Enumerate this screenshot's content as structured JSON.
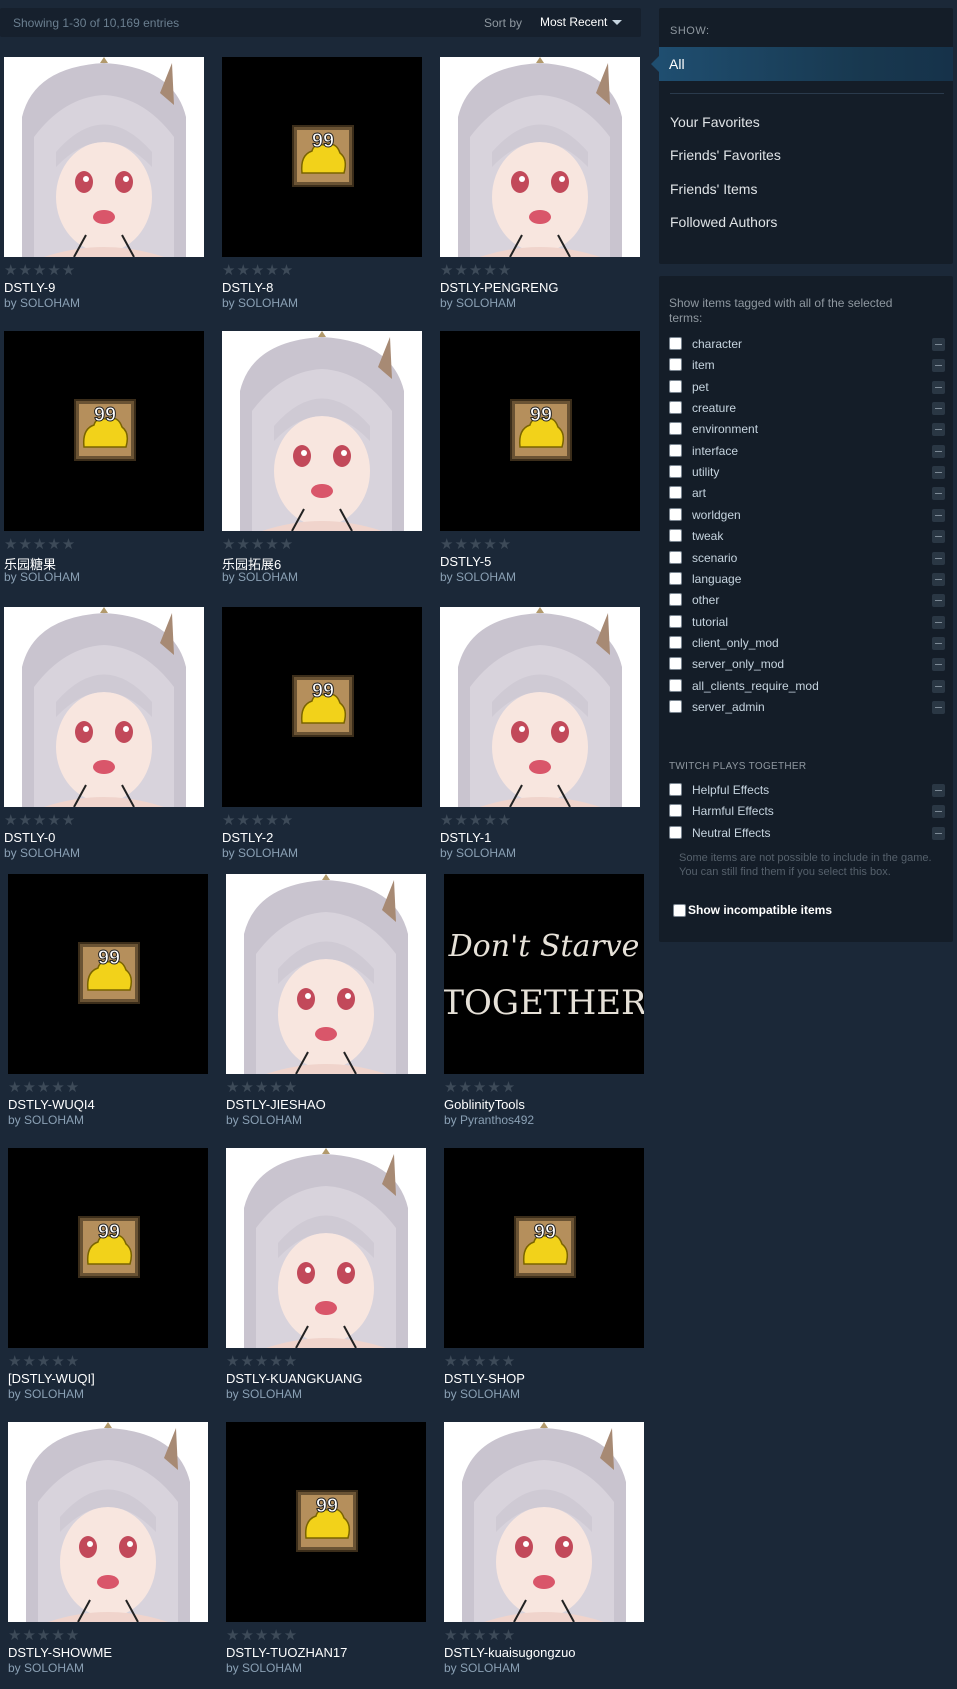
{
  "header": {
    "count_text": "Showing 1-30 of 10,169 entries",
    "sort_label": "Sort by",
    "sort_value": "Most Recent"
  },
  "items": [
    {
      "title": "DSTLY-9",
      "author": "by SOLOHAM",
      "thumb": "girl-portrait"
    },
    {
      "title": "DSTLY-8",
      "author": "by SOLOHAM",
      "thumb": "gold-99-icon"
    },
    {
      "title": "DSTLY-PENGRENG",
      "author": "by SOLOHAM",
      "thumb": "girl-portrait"
    },
    {
      "title": "乐园糖果",
      "author": "by SOLOHAM",
      "thumb": "gold-99-icon"
    },
    {
      "title": "乐园拓展6",
      "author": "by SOLOHAM",
      "thumb": "girl-portrait"
    },
    {
      "title": "DSTLY-5",
      "author": "by SOLOHAM",
      "thumb": "gold-99-icon"
    },
    {
      "title": "DSTLY-0",
      "author": "by SOLOHAM",
      "thumb": "girl-portrait"
    },
    {
      "title": "DSTLY-2",
      "author": "by SOLOHAM",
      "thumb": "gold-99-icon"
    },
    {
      "title": "DSTLY-1",
      "author": "by SOLOHAM",
      "thumb": "girl-portrait"
    },
    {
      "title": "DSTLY-WUQI4",
      "author": "by SOLOHAM",
      "thumb": "gold-99-icon"
    },
    {
      "title": "DSTLY-JIESHAO",
      "author": "by SOLOHAM",
      "thumb": "girl-portrait"
    },
    {
      "title": "GoblinityTools",
      "author": "by Pyranthos492",
      "thumb": "dont-starve-together-logo",
      "logo_line1": "Don't Starve",
      "logo_line2": "TOGETHER"
    },
    {
      "title": "[DSTLY-WUQI]",
      "author": "by SOLOHAM",
      "thumb": "gold-99-icon"
    },
    {
      "title": "DSTLY-KUANGKUANG",
      "author": "by SOLOHAM",
      "thumb": "girl-portrait"
    },
    {
      "title": "DSTLY-SHOP",
      "author": "by SOLOHAM",
      "thumb": "gold-99-icon"
    },
    {
      "title": "DSTLY-SHOWME",
      "author": "by SOLOHAM",
      "thumb": "girl-portrait"
    },
    {
      "title": "DSTLY-TUOZHAN17",
      "author": "by SOLOHAM",
      "thumb": "gold-99-icon"
    },
    {
      "title": "DSTLY-kuaisugongzuo",
      "author": "by SOLOHAM",
      "thumb": "girl-portrait"
    }
  ],
  "stars_text": "★★★★★",
  "icon_number": "99",
  "sidebar": {
    "show_label": "SHOW:",
    "all_label": "All",
    "nav": [
      "Your Favorites",
      "Friends' Favorites",
      "Friends' Items",
      "Followed Authors"
    ],
    "tag_heading": "Show items tagged with all of the selected terms:",
    "tags": [
      "character",
      "item",
      "pet",
      "creature",
      "environment",
      "interface",
      "utility",
      "art",
      "worldgen",
      "tweak",
      "scenario",
      "language",
      "other",
      "tutorial",
      "client_only_mod",
      "server_only_mod",
      "all_clients_require_mod",
      "server_admin"
    ],
    "twitch_heading": "TWITCH PLAYS TOGETHER",
    "twitch_tags": [
      "Helpful Effects",
      "Harmful Effects",
      "Neutral Effects"
    ],
    "note": "Some items are not possible to include in the game. You can still find them if you select this box.",
    "incompat_label": "Show incompatible items"
  },
  "colors": {
    "background": "#1b2838",
    "accent": "#1f4e70",
    "gold": "#f2d21a"
  }
}
